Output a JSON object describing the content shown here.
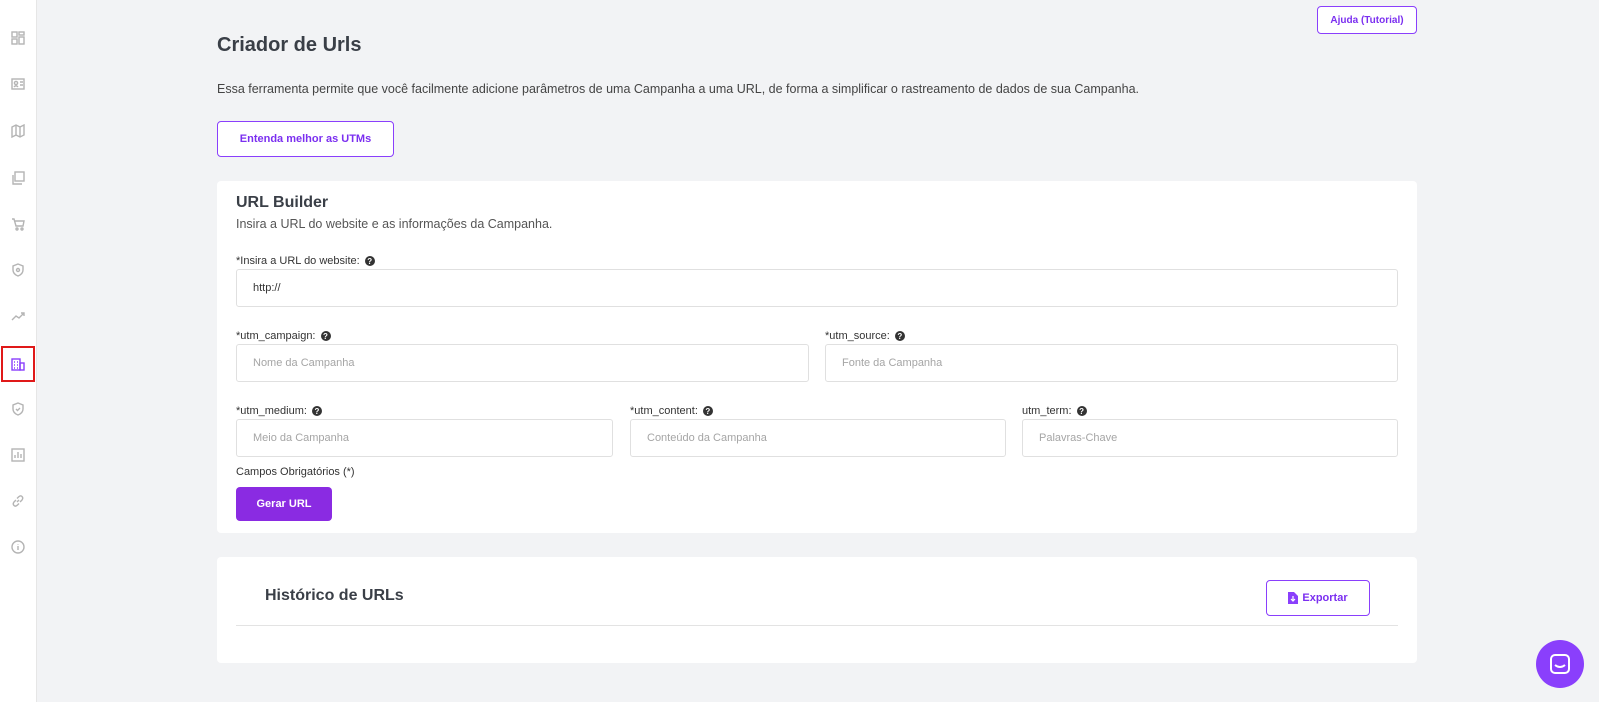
{
  "header": {
    "help_label": "Ajuda (Tutorial)",
    "title": "Criador de Urls",
    "intro": "Essa ferramenta permite que você facilmente adicione parâmetros de uma Campanha a uma URL, de forma a simplificar o rastreamento de dados de sua Campanha.",
    "utm_button": "Entenda melhor as UTMs"
  },
  "builder": {
    "title": "URL Builder",
    "subtitle": "Insira a URL do website e as informações da Campanha.",
    "fields": {
      "website": {
        "label": "*Insira a URL do website:",
        "value": "http://",
        "placeholder": ""
      },
      "campaign": {
        "label": "*utm_campaign:",
        "value": "",
        "placeholder": "Nome da Campanha"
      },
      "source": {
        "label": "*utm_source:",
        "value": "",
        "placeholder": "Fonte da Campanha"
      },
      "medium": {
        "label": "*utm_medium:",
        "value": "",
        "placeholder": "Meio da Campanha"
      },
      "content": {
        "label": "*utm_content:",
        "value": "",
        "placeholder": "Conteúdo da Campanha"
      },
      "term": {
        "label": "utm_term:",
        "value": "",
        "placeholder": "Palavras-Chave"
      }
    },
    "required_note": "Campos Obrigatórios (*)",
    "generate_label": "Gerar URL"
  },
  "history": {
    "title": "Histórico de URLs",
    "export_label": "Exportar"
  },
  "sidebar": {
    "icons": [
      "dashboard-icon",
      "contact-card-icon",
      "map-icon",
      "pages-icon",
      "cart-icon",
      "shield-icon",
      "trend-icon",
      "building-icon",
      "security-icon",
      "report-icon",
      "link-icon",
      "info-icon"
    ],
    "active": "building-icon"
  },
  "colors": {
    "accent": "#8a2be2",
    "active_outline": "#e01919",
    "background": "#f2f3f5"
  }
}
